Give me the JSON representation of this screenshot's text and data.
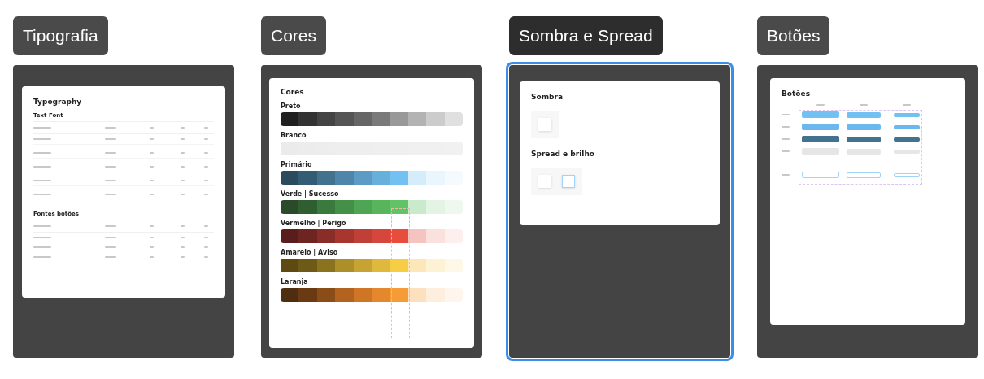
{
  "frames": [
    {
      "label": "Tipografia",
      "selected": false,
      "kind": "typography",
      "title": "Typography",
      "sections": [
        "Text Font",
        "Fontes botões"
      ]
    },
    {
      "label": "Cores",
      "selected": false,
      "kind": "colors",
      "title": "Cores",
      "palettes": [
        {
          "name": "Preto",
          "swatches": [
            {
              "color": "#1f1f1f"
            },
            {
              "color": "#333333"
            },
            {
              "color": "#444444"
            },
            {
              "color": "#555555"
            },
            {
              "color": "#666666"
            },
            {
              "color": "#7a7a7a"
            },
            {
              "color": "#999999"
            },
            {
              "color": "#b3b3b3"
            },
            {
              "color": "#cccccc"
            },
            {
              "color": "#e0e0e0"
            }
          ]
        },
        {
          "name": "Branco",
          "swatches": [
            {
              "color": "#ebebeb"
            },
            {
              "color": "#ececec"
            },
            {
              "color": "#ededed"
            },
            {
              "color": "#eeeeee"
            },
            {
              "color": "#eeeeee"
            },
            {
              "color": "#efefef"
            },
            {
              "color": "#efefef"
            },
            {
              "color": "#f0f0f0"
            },
            {
              "color": "#f0f0f0"
            },
            {
              "color": "#f1f1f1"
            }
          ]
        },
        {
          "name": "Primário",
          "swatches": [
            {
              "color": "#2b4a5e"
            },
            {
              "color": "#345d75"
            },
            {
              "color": "#43728f"
            },
            {
              "color": "#4e86ab"
            },
            {
              "color": "#5b9bc6"
            },
            {
              "color": "#68b0dc"
            },
            {
              "color": "#73c0f2"
            },
            {
              "color": "#d5ecfb"
            },
            {
              "color": "#eaf6fd"
            },
            {
              "color": "#f4fafe"
            }
          ]
        },
        {
          "name": "Verde | Sucesso",
          "swatches": [
            {
              "color": "#2a4a2a"
            },
            {
              "color": "#2f5e30"
            },
            {
              "color": "#3a7a3d"
            },
            {
              "color": "#449049"
            },
            {
              "color": "#4ea553"
            },
            {
              "color": "#58b55c"
            },
            {
              "color": "#62c266"
            },
            {
              "color": "#c9ebcb"
            },
            {
              "color": "#e3f4e4"
            },
            {
              "color": "#eef8ee"
            }
          ]
        },
        {
          "name": "Vermelho | Perigo",
          "swatches": [
            {
              "color": "#5a1d1d"
            },
            {
              "color": "#6e2421"
            },
            {
              "color": "#8a2c27"
            },
            {
              "color": "#a8362f"
            },
            {
              "color": "#c03f36"
            },
            {
              "color": "#d5463c"
            },
            {
              "color": "#e84c3d"
            },
            {
              "color": "#f5c4c0"
            },
            {
              "color": "#fae1de"
            },
            {
              "color": "#fcefed"
            }
          ]
        },
        {
          "name": "Amarelo | Aviso",
          "swatches": [
            {
              "color": "#5e4a10"
            },
            {
              "color": "#6e5a17"
            },
            {
              "color": "#8a721f"
            },
            {
              "color": "#ad8f2a"
            },
            {
              "color": "#c6a332"
            },
            {
              "color": "#deb93c"
            },
            {
              "color": "#f6cd45"
            },
            {
              "color": "#fce7b8"
            },
            {
              "color": "#fdf2d4"
            },
            {
              "color": "#fef8e8"
            }
          ]
        },
        {
          "name": "Laranja",
          "swatches": [
            {
              "color": "#4e2d10"
            },
            {
              "color": "#6a3a13"
            },
            {
              "color": "#8a4d18"
            },
            {
              "color": "#b1631f"
            },
            {
              "color": "#cf7626"
            },
            {
              "color": "#e5872c"
            },
            {
              "color": "#f59c36"
            },
            {
              "color": "#fde0bd"
            },
            {
              "color": "#fdeedd"
            },
            {
              "color": "#fef6ee"
            }
          ]
        }
      ]
    },
    {
      "label": "Sombra e Spread",
      "selected": true,
      "kind": "shadow",
      "groups": [
        {
          "heading": "Sombra",
          "samples": [
            {
              "kind": "shadow"
            }
          ]
        },
        {
          "heading": "Spread e brilho",
          "samples": [
            {
              "kind": "shadow"
            },
            {
              "kind": "glow"
            }
          ]
        }
      ]
    },
    {
      "label": "Botões",
      "selected": false,
      "kind": "buttons",
      "title": "Botões",
      "rows": [
        {
          "kind": "default"
        },
        {
          "kind": "hover"
        },
        {
          "kind": "press"
        },
        {
          "kind": "disabled"
        },
        {
          "kind": "outline"
        }
      ]
    }
  ]
}
